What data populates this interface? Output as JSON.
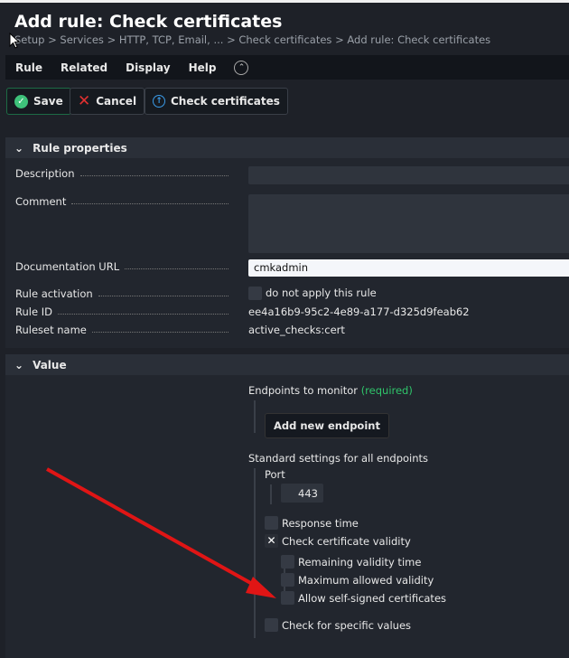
{
  "header": {
    "title": "Add rule: Check certificates",
    "breadcrumb": "Setup > Services > HTTP, TCP, Email, ... > Check certificates > Add rule: Check certificates"
  },
  "menu": {
    "items": [
      "Rule",
      "Related",
      "Display",
      "Help"
    ]
  },
  "toolbar": {
    "save": "Save",
    "cancel": "Cancel",
    "check": "Check certificates"
  },
  "rule_properties": {
    "title": "Rule properties",
    "description_label": "Description",
    "description_value": "",
    "comment_label": "Comment",
    "comment_value": "",
    "doc_url_label": "Documentation URL",
    "doc_url_value": "cmkadmin",
    "activation_label": "Rule activation",
    "activation_option": "do not apply this rule",
    "rule_id_label": "Rule ID",
    "rule_id": "ee4a16b9-95c2-4e89-a177-d325d9feab62",
    "ruleset_label": "Ruleset name",
    "ruleset": "active_checks:cert"
  },
  "value": {
    "title": "Value",
    "endpoints_label": "Endpoints to monitor",
    "required": "(required)",
    "add_endpoint": "Add new endpoint",
    "standard_label": "Standard settings for all endpoints",
    "port_label": "Port",
    "port_value": "443",
    "response_time": "Response time",
    "check_validity": "Check certificate validity",
    "remaining": "Remaining validity time",
    "max_allowed": "Maximum allowed validity",
    "self_signed": "Allow self-signed certificates",
    "specific": "Check for specific values"
  }
}
